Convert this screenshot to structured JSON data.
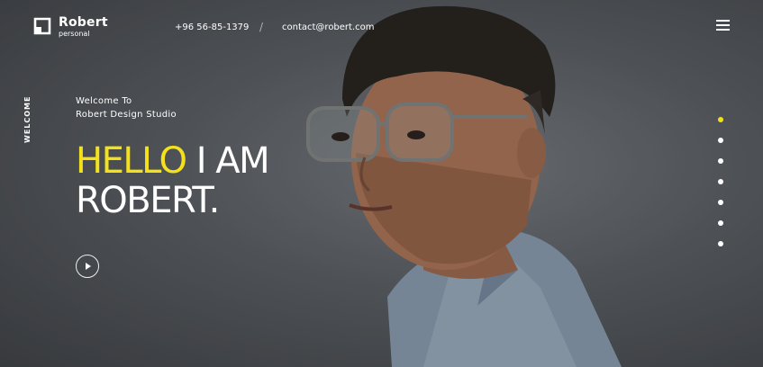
{
  "brand": {
    "name": "Robert",
    "subtitle": "personal"
  },
  "contact": {
    "phone": "+96 56-85-1379",
    "separator": "/",
    "email": "contact@robert.com"
  },
  "side_label": "WELCOME",
  "intro": {
    "line1": "Welcome To",
    "line2": "Robert Design Studio"
  },
  "headline": {
    "highlight": "HELLO",
    "rest": "I AM",
    "name": "ROBERT."
  },
  "colors": {
    "accent": "#f5e11a",
    "text": "#ffffff",
    "background": "#5f6368"
  },
  "icons": {
    "menu": "hamburger-icon",
    "play": "play-icon"
  },
  "pagination": {
    "total": 7,
    "active": 1
  }
}
